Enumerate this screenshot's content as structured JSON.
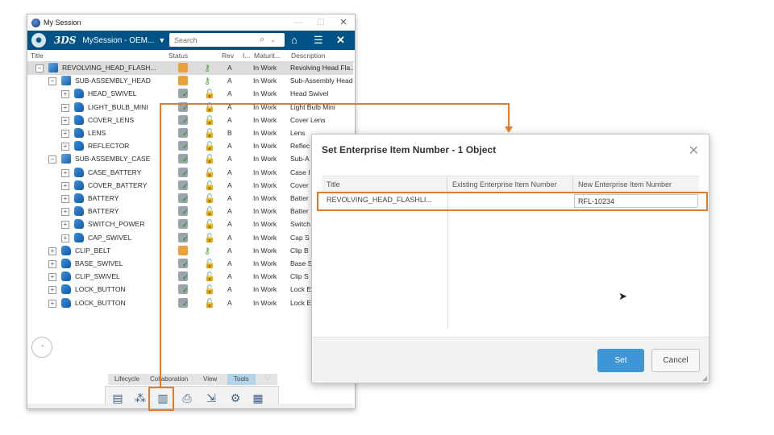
{
  "window": {
    "title": "My Session",
    "controls": [
      "—",
      "☐",
      "✕"
    ]
  },
  "toolbar": {
    "session_name": "MySession - OEM...",
    "search_placeholder": "Search",
    "logo": "3DS"
  },
  "columns": [
    "Title",
    "Status",
    "Rev",
    "I...",
    "Maturit...",
    "Description"
  ],
  "tree_rows": [
    {
      "indent": 0,
      "type": "asm",
      "title": "REVOLVING_HEAD_FLASH...",
      "status": "lock",
      "locked": "key",
      "rev": "A",
      "maturity": "In Work",
      "desc": "Revolving Head Fla...",
      "selected": true
    },
    {
      "indent": 1,
      "type": "asm",
      "title": "SUB-ASSEMBLY_HEAD",
      "status": "lock",
      "locked": "key",
      "rev": "A",
      "maturity": "In Work",
      "desc": "Sub-Assembly Head"
    },
    {
      "indent": 2,
      "type": "part",
      "title": "HEAD_SWIVEL",
      "status": "ok",
      "locked": "open",
      "rev": "A",
      "maturity": "In Work",
      "desc": "Head Swivel"
    },
    {
      "indent": 2,
      "type": "part",
      "title": "LIGHT_BULB_MINI",
      "status": "ok",
      "locked": "open",
      "rev": "A",
      "maturity": "In Work",
      "desc": "Light Bulb Mini"
    },
    {
      "indent": 2,
      "type": "part",
      "title": "COVER_LENS",
      "status": "ok",
      "locked": "open",
      "rev": "A",
      "maturity": "In Work",
      "desc": "Cover Lens"
    },
    {
      "indent": 2,
      "type": "part",
      "title": "LENS",
      "status": "ok",
      "locked": "open",
      "rev": "B",
      "maturity": "In Work",
      "desc": "Lens"
    },
    {
      "indent": 2,
      "type": "part",
      "title": "REFLECTOR",
      "status": "ok",
      "locked": "open",
      "rev": "A",
      "maturity": "In Work",
      "desc": "Reflec"
    },
    {
      "indent": 1,
      "type": "asm",
      "title": "SUB-ASSEMBLY_CASE",
      "status": "ok",
      "locked": "open",
      "rev": "A",
      "maturity": "In Work",
      "desc": "Sub-A"
    },
    {
      "indent": 2,
      "type": "part",
      "title": "CASE_BATTERY",
      "status": "ok",
      "locked": "open",
      "rev": "A",
      "maturity": "In Work",
      "desc": "Case I"
    },
    {
      "indent": 2,
      "type": "part",
      "title": "COVER_BATTERY",
      "status": "ok",
      "locked": "open",
      "rev": "A",
      "maturity": "In Work",
      "desc": "Cover"
    },
    {
      "indent": 2,
      "type": "part",
      "title": "BATTERY",
      "status": "ok",
      "locked": "open",
      "rev": "A",
      "maturity": "In Work",
      "desc": "Batter"
    },
    {
      "indent": 2,
      "type": "part",
      "title": "BATTERY",
      "status": "ok",
      "locked": "open",
      "rev": "A",
      "maturity": "In Work",
      "desc": "Batter"
    },
    {
      "indent": 2,
      "type": "part",
      "title": "SWITCH_POWER",
      "status": "ok",
      "locked": "open",
      "rev": "A",
      "maturity": "In Work",
      "desc": "Switch"
    },
    {
      "indent": 2,
      "type": "part",
      "title": "CAP_SWIVEL",
      "status": "ok",
      "locked": "open",
      "rev": "A",
      "maturity": "In Work",
      "desc": "Cap S"
    },
    {
      "indent": 1,
      "type": "part",
      "title": "CLIP_BELT",
      "status": "lock",
      "locked": "key",
      "rev": "A",
      "maturity": "In Work",
      "desc": "Clip B"
    },
    {
      "indent": 1,
      "type": "part",
      "title": "BASE_SWIVEL",
      "status": "ok",
      "locked": "open",
      "rev": "A",
      "maturity": "In Work",
      "desc": "Base S"
    },
    {
      "indent": 1,
      "type": "part",
      "title": "CLIP_SWIVEL",
      "status": "ok",
      "locked": "open",
      "rev": "A",
      "maturity": "In Work",
      "desc": "Clip S"
    },
    {
      "indent": 1,
      "type": "part",
      "title": "LOCK_BUTTON",
      "status": "ok",
      "locked": "open",
      "rev": "A",
      "maturity": "In Work",
      "desc": "Lock E"
    },
    {
      "indent": 1,
      "type": "part",
      "title": "LOCK_BUTTON",
      "status": "ok",
      "locked": "open",
      "rev": "A",
      "maturity": "In Work",
      "desc": "Lock E"
    }
  ],
  "tabs": {
    "lifecycle": "Lifecycle",
    "collaboration": "Collaboration",
    "view": "View",
    "tools": "Tools"
  },
  "dialog": {
    "title": "Set Enterprise Item Number - 1 Object",
    "col_title": "Title",
    "col_existing": "Existing Enterprise Item Number",
    "col_new": "New Enterprise Item Number",
    "row_title": "REVOLVING_HEAD_FLASHLI...",
    "row_existing": "",
    "row_new": "RFL-10234",
    "set_label": "Set",
    "cancel_label": "Cancel"
  },
  "colors": {
    "accent": "#005386",
    "highlight": "#e07b2b",
    "primary_button": "#3f96d6"
  }
}
